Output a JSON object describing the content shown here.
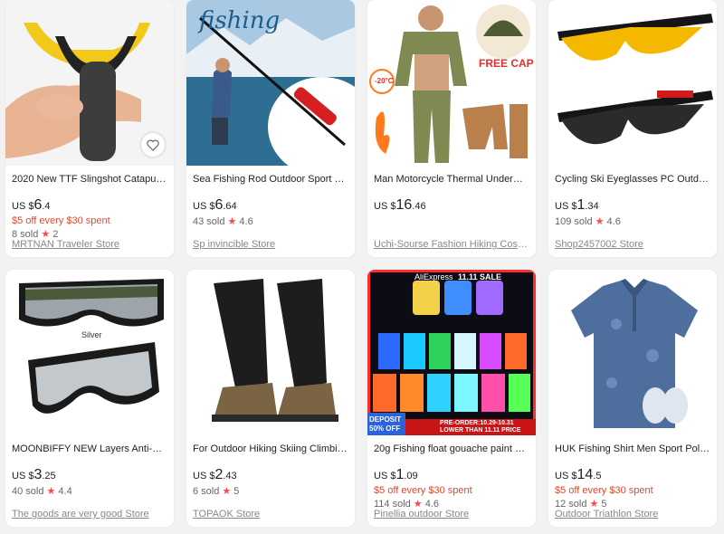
{
  "products": [
    {
      "title": "2020 New TTF Slingshot Catapult ...",
      "currency": "US $",
      "price_int": "6",
      "price_dec": ".4",
      "promo": "$5 off every $30 spent",
      "sold": "8 sold",
      "rating": "2",
      "store": "MRTNAN Traveler Store"
    },
    {
      "title": "Sea Fishing Rod Outdoor Sport Por...",
      "currency": "US $",
      "price_int": "6",
      "price_dec": ".64",
      "promo": "",
      "sold": "43 sold",
      "rating": "4.6",
      "store": "Sp invincible Store",
      "image_text": "fishing"
    },
    {
      "title": "Man Motorcycle Thermal Underwe...",
      "currency": "US $",
      "price_int": "16",
      "price_dec": ".46",
      "promo": "",
      "sold": "",
      "rating": "",
      "store": "Uchi-Sourse Fashion Hiking Costu...",
      "image_text": "FREE CAP",
      "image_badge": "-20°C"
    },
    {
      "title": "Cycling Ski Eyeglasses PC Outdoor ...",
      "currency": "US $",
      "price_int": "1",
      "price_dec": ".34",
      "promo": "",
      "sold": "109 sold",
      "rating": "4.6",
      "store": "Shop2457002 Store"
    },
    {
      "title": "MOONBIFFY NEW Layers Anti-Fog ...",
      "currency": "US $",
      "price_int": "3",
      "price_dec": ".25",
      "promo": "",
      "sold": "40 sold",
      "rating": "4.4",
      "store": "The goods are very good Store",
      "image_text": "Silver"
    },
    {
      "title": "For Outdoor Hiking Skiing Climbin...",
      "currency": "US $",
      "price_int": "2",
      "price_dec": ".43",
      "promo": "",
      "sold": "6 sold",
      "rating": "5",
      "store": "TOPAOK Store"
    },
    {
      "title": "20g Fishing float gouache paint Gl...",
      "currency": "US $",
      "price_int": "1",
      "price_dec": ".09",
      "promo": "$5 off every $30 spent",
      "sold": "114 sold",
      "rating": "4.6",
      "store": "Pinellia outdoor Store",
      "image_banner": "AliExpress",
      "image_sale": "11.11 SALE",
      "image_deposit": "DEPOSIT",
      "image_off": "50% OFF",
      "image_preorder": "PRE-ORDER:10.29-10.31",
      "image_lower": "LOWER THAN 11.11 PRICE"
    },
    {
      "title": "HUK Fishing Shirt Men Sport Polo ...",
      "currency": "US $",
      "price_int": "14",
      "price_dec": ".5",
      "promo": "$5 off every $30 spent",
      "sold": "12 sold",
      "rating": "5",
      "store": "Outdoor Triathlon Store"
    }
  ],
  "colors": {
    "promo": "#e2492d",
    "star": "#ff4747",
    "store": "#888888"
  },
  "icons": {
    "favorite": "heart-icon",
    "rating": "star-icon"
  }
}
